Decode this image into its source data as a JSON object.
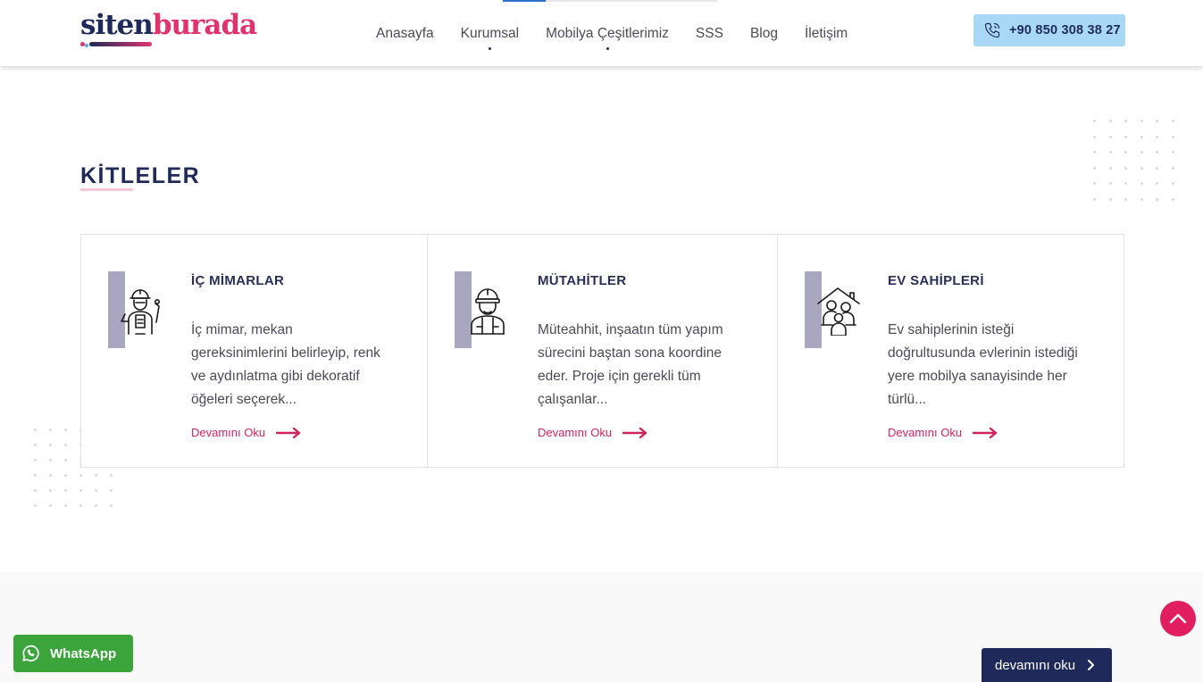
{
  "brand": {
    "logo_part1": "siten",
    "logo_part2": "burada",
    "colors": {
      "navy": "#1f2a5a",
      "pink": "#e0336e",
      "light_blue": "#a8d8f3"
    }
  },
  "nav": {
    "items": [
      {
        "label": "Anasayfa",
        "has_dropdown": false
      },
      {
        "label": "Kurumsal",
        "has_dropdown": true
      },
      {
        "label": "Mobilya Çeşitlerimiz",
        "has_dropdown": true
      },
      {
        "label": "SSS",
        "has_dropdown": false
      },
      {
        "label": "Blog",
        "has_dropdown": false
      },
      {
        "label": "İletişim",
        "has_dropdown": false
      }
    ]
  },
  "phone": {
    "icon": "phone-icon",
    "number": "+90 850 308 38 27"
  },
  "section": {
    "title": "KİTLELER"
  },
  "cards": [
    {
      "icon": "architect-icon",
      "title": "İÇ MİMARLAR",
      "description": "İç mimar, mekan gereksinimlerini belirleyip, renk ve aydınlatma gibi dekoratif öğeleri seçerek...",
      "more_label": "Devamını Oku"
    },
    {
      "icon": "contractor-icon",
      "title": "MÜTAHİTLER",
      "description": "Müteahhit, inşaatın tüm yapım sürecini baştan sona koordine eder. Proje için gerekli tüm çalışanlar...",
      "more_label": "Devamını Oku"
    },
    {
      "icon": "homeowner-family-icon",
      "title": "EV SAHİPLERİ",
      "description": "Ev sahiplerinin isteği doğrultusunda evlerinin istediği yere mobilya sanayisinde her türlü...",
      "more_label": "Devamını Oku"
    }
  ],
  "whatsapp": {
    "icon": "whatsapp-icon",
    "label": "WhatsApp"
  },
  "scroll_top": {
    "icon": "chevron-up-icon"
  },
  "devamini_button": {
    "label": "devamını oku",
    "icon": "chevron-right-icon"
  }
}
